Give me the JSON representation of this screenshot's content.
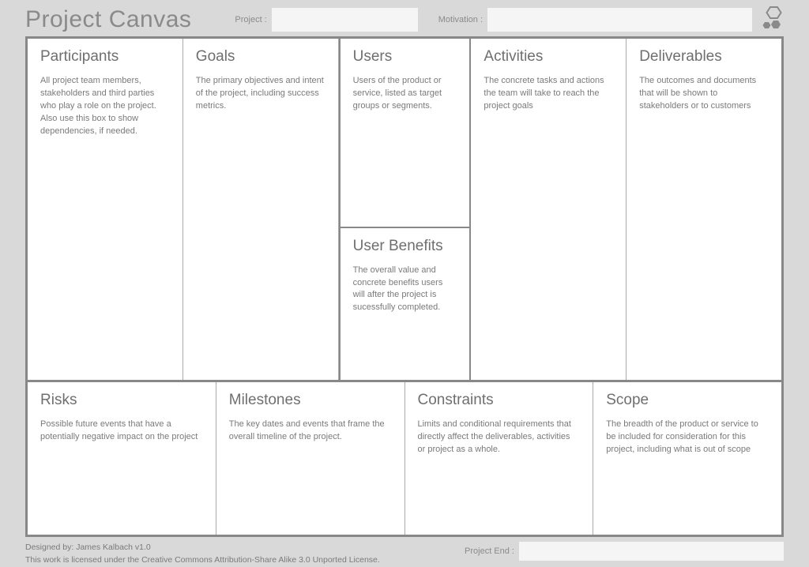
{
  "header": {
    "title": "Project Canvas",
    "project_label": "Project :",
    "motivation_label": "Motivation :"
  },
  "cells": {
    "participants": {
      "title": "Participants",
      "desc": "All project team members, stakeholders and third parties who play a role on the project. Also use this box to show dependencies, if needed."
    },
    "goals": {
      "title": "Goals",
      "desc": "The primary objectives and intent of the project, including success metrics."
    },
    "users": {
      "title": "Users",
      "desc": "Users of the product or service, listed as target groups or segments."
    },
    "user_benefits": {
      "title": "User Benefits",
      "desc": "The overall value and concrete benefits users will after the project is sucessfully completed."
    },
    "activities": {
      "title": "Activities",
      "desc": "The concrete tasks and actions the team will take to reach the project goals"
    },
    "deliverables": {
      "title": "Deliverables",
      "desc": "The outcomes and documents that will be shown to stakeholders or to customers"
    },
    "risks": {
      "title": "Risks",
      "desc": "Possible future events that have a potentially negative impact on the project"
    },
    "milestones": {
      "title": "Milestones",
      "desc": "The key dates and events that frame the overall timeline of the project."
    },
    "constraints": {
      "title": "Constraints",
      "desc": "Limits and conditional requirements that directly affect the deliverables, activities or project as a whole."
    },
    "scope": {
      "title": "Scope",
      "desc": "The breadth of the product or service to be included for consideration for this project, including what is out of scope"
    }
  },
  "footer": {
    "credit": "Designed by: James Kalbach v1.0",
    "license": "This work is licensed under the Creative Commons Attribution-Share Alike 3.0 Unported License.",
    "project_end_label": "Project End :"
  }
}
